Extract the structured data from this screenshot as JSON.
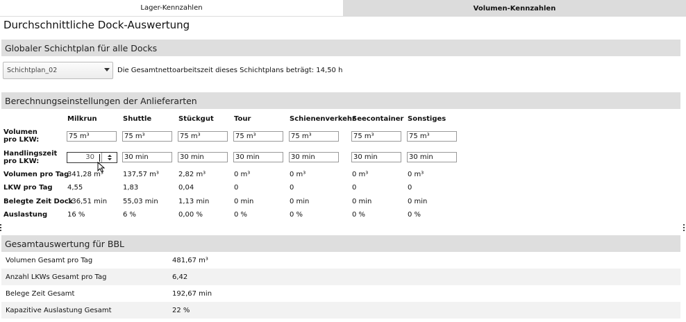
{
  "tabs": [
    {
      "label": "Lager-Kennzahlen",
      "active": false
    },
    {
      "label": "Volumen-Kennzahlen",
      "active": true
    }
  ],
  "page_title": "Durchschnittliche Dock-Auswertung",
  "sections": {
    "schichtplan": "Globaler Schichtplan für alle Docks",
    "berechnung": "Berechnungseinstellungen der Anlieferarten",
    "gesamt": "Gesamtauswertung für BBL"
  },
  "schichtplan": {
    "selected": "Schichtplan_02",
    "info": "Die Gesamtnettoarbeitszeit dieses Schichtplans beträgt: 14,50 h"
  },
  "columns": [
    "Milkrun",
    "Shuttle",
    "Stückgut",
    "Tour",
    "Schienenverkehr",
    "Seecontainer",
    "Sonstiges"
  ],
  "row_labels": {
    "volumen_lkw": [
      "Volumen",
      "pro LKW:"
    ],
    "handling": [
      "Handlingszeit",
      "pro LKW:"
    ],
    "volumen_tag": "Volumen pro Tag",
    "lkw_tag": "LKW pro Tag",
    "belegte_zeit": "Belegte Zeit Dock",
    "auslastung": "Auslastung"
  },
  "volumen_lkw": [
    "75 m³",
    "75 m³",
    "75 m³",
    "75 m³",
    "75 m³",
    "75 m³",
    "75 m³"
  ],
  "handling": [
    "30",
    "30 min",
    "30 min",
    "30 min",
    "30 min",
    "30 min",
    "30 min"
  ],
  "volumen_tag": [
    "341,28 m³",
    "137,57 m³",
    "2,82 m³",
    "0 m³",
    "0 m³",
    "0 m³",
    "0 m³"
  ],
  "lkw_tag": [
    "4,55",
    "1,83",
    "0,04",
    "0",
    "0",
    "0",
    "0"
  ],
  "belegte_zeit": [
    "136,51 min",
    "55,03 min",
    "1,13 min",
    "0 min",
    "0 min",
    "0 min",
    "0 min"
  ],
  "auslastung": [
    "16 %",
    "6 %",
    "0,00 %",
    "0 %",
    "0 %",
    "0 %",
    "0 %"
  ],
  "summary": [
    {
      "label": "Volumen Gesamt pro Tag",
      "value": "481,67 m³"
    },
    {
      "label": "Anzahl LKWs Gesamt pro Tag",
      "value": "6,42"
    },
    {
      "label": "Belege Zeit Gesamt",
      "value": "192,67 min"
    },
    {
      "label": "Kapazitive Auslastung Gesamt",
      "value": "22 %"
    }
  ],
  "icons": {
    "dropdown": "chevron-down-icon",
    "spinner": "spinner-arrows-icon",
    "cursor": "mouse-pointer-icon"
  }
}
